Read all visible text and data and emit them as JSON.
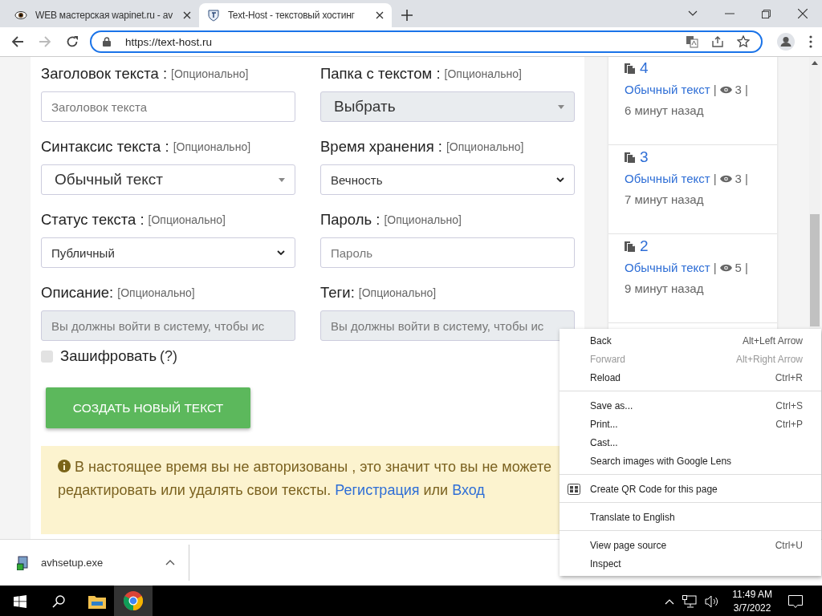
{
  "browser": {
    "tabs": [
      {
        "title": "WEB мастерская wapinet.ru - av",
        "selected": false
      },
      {
        "title": "Text-Host - текстовый хостинг",
        "selected": true
      }
    ],
    "address": "https://text-host.ru"
  },
  "form": {
    "fields": [
      {
        "label": "Заголовок текста :",
        "hint": "[Опционально]",
        "kind": "input",
        "placeholder": "Заголовок текста",
        "disabled": false
      },
      {
        "label": "Папка с текстом :",
        "hint": "[Опционально]",
        "kind": "custom-select",
        "value": "Выбрать",
        "disabled": true
      },
      {
        "label": "Синтаксис текста :",
        "hint": "[Опционально]",
        "kind": "custom-select",
        "value": "Обычный текст",
        "disabled": false
      },
      {
        "label": "Время хранения :",
        "hint": "[Опционально]",
        "kind": "select",
        "value": "Вечность",
        "disabled": false
      },
      {
        "label": "Статус текста :",
        "hint": "[Опционально]",
        "kind": "select",
        "value": "Публичный",
        "disabled": false
      },
      {
        "label": "Пароль :",
        "hint": "[Опционально]",
        "kind": "input",
        "placeholder": "Пароль",
        "disabled": false
      },
      {
        "label": "Описание:",
        "hint": "[Опционально]",
        "kind": "input",
        "placeholder": "Вы должны войти в систему, чтобы ис",
        "disabled": true
      },
      {
        "label": "Теги:",
        "hint": "[Опционально]",
        "kind": "input",
        "placeholder": "Вы должны войти в систему, чтобы ис",
        "disabled": true
      }
    ],
    "encrypt": {
      "label": "Зашифровать",
      "help": "(?)",
      "checked": false
    },
    "submit": "СОЗДАТЬ НОВЫЙ ТЕКСТ",
    "alert": {
      "text": "В настоящее время вы не авторизованы , это значит что вы не можете редактировать или удалять свои тексты.",
      "register": "Регистрация",
      "or": "или",
      "login": "Вход"
    }
  },
  "recent": {
    "separator": "|",
    "items": [
      {
        "title": "4",
        "syntax": "Обычный текст",
        "views": "3",
        "time": "6 минут назад"
      },
      {
        "title": "3",
        "syntax": "Обычный текст",
        "views": "3",
        "time": "7 минут назад"
      },
      {
        "title": "2",
        "syntax": "Обычный текст",
        "views": "5",
        "time": "9 минут назад"
      }
    ]
  },
  "context_menu": [
    [
      {
        "label": "Back",
        "shortcut": "Alt+Left Arrow",
        "disabled": false,
        "kind": "plain"
      },
      {
        "label": "Forward",
        "shortcut": "Alt+Right Arrow",
        "disabled": true,
        "kind": "plain"
      },
      {
        "label": "Reload",
        "shortcut": "Ctrl+R",
        "disabled": false,
        "kind": "plain"
      }
    ],
    [
      {
        "label": "Save as...",
        "shortcut": "Ctrl+S",
        "disabled": false,
        "kind": "plain"
      },
      {
        "label": "Print...",
        "shortcut": "Ctrl+P",
        "disabled": false,
        "kind": "plain"
      },
      {
        "label": "Cast...",
        "disabled": false,
        "kind": "plain"
      },
      {
        "label": "Search images with Google Lens",
        "disabled": false,
        "kind": "plain"
      }
    ],
    [
      {
        "label": "Create QR Code for this page",
        "disabled": false,
        "kind": "qr"
      }
    ],
    [
      {
        "label": "Translate to English",
        "disabled": false,
        "kind": "plain"
      }
    ],
    [
      {
        "label": "View page source",
        "shortcut": "Ctrl+U",
        "disabled": false,
        "kind": "plain"
      },
      {
        "label": "Inspect",
        "disabled": false,
        "kind": "plain"
      }
    ]
  ],
  "download": {
    "file": "avhsetup.exe"
  },
  "taskbar": {
    "time": "11:49 AM",
    "date": "3/7/2022"
  }
}
